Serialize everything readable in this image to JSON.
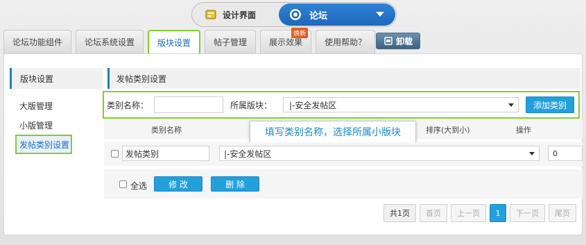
{
  "switch": {
    "left_label": "设计界面",
    "right_label": "论坛",
    "left_icon": "palette-icon",
    "right_icon": "gear-icon"
  },
  "tabs": [
    {
      "label": "论坛功能组件",
      "active": false
    },
    {
      "label": "论坛系统设置",
      "active": false
    },
    {
      "label": "版块设置",
      "active": true
    },
    {
      "label": "帖子管理",
      "active": false
    },
    {
      "label": "展示效果",
      "active": false,
      "badge": "焕新"
    },
    {
      "label": "使用帮助？",
      "active": false
    }
  ],
  "uninstall_label": "卸载",
  "sidebar": {
    "title": "版块设置",
    "items": [
      {
        "label": "大版管理"
      },
      {
        "label": "小版管理"
      },
      {
        "label": "发帖类别设置",
        "active": true
      }
    ]
  },
  "main": {
    "title": "发帖类别设置",
    "filter": {
      "name_label": "类别名称：",
      "name_value": "",
      "board_label": "所属版块：",
      "board_selected": "|-安全发帖区",
      "add_button": "添加类别"
    },
    "columns": [
      "类别名称",
      "排序(大到小)",
      "操作"
    ],
    "tooltip": "填写类别名称，选择所属小版块",
    "rows": [
      {
        "name": "发帖类别",
        "board": "|-安全发帖区",
        "order": "0"
      }
    ],
    "bulk": {
      "select_all": "全选",
      "edit": "修 改",
      "delete": "删 除"
    },
    "pager": {
      "total": "共1页",
      "first": "首页",
      "prev": "上一页",
      "current": "1",
      "next": "下一页",
      "last": "尾页"
    }
  },
  "colors": {
    "accent": "#23a0dc",
    "highlight": "#7dd12a",
    "brand_blue": "#1d68bb"
  }
}
